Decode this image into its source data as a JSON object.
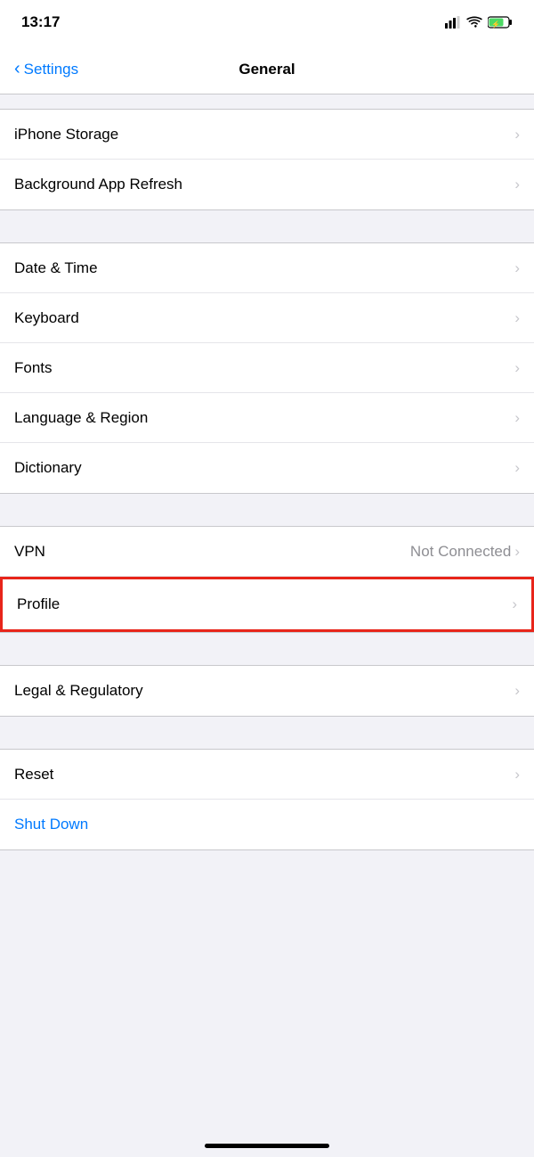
{
  "statusBar": {
    "time": "13:17"
  },
  "navBar": {
    "backLabel": "Settings",
    "title": "General"
  },
  "sections": [
    {
      "id": "storage-refresh",
      "items": [
        {
          "label": "iPhone Storage",
          "value": "",
          "chevron": "›"
        },
        {
          "label": "Background App Refresh",
          "value": "",
          "chevron": "›"
        }
      ]
    },
    {
      "id": "datetime-language",
      "items": [
        {
          "label": "Date & Time",
          "value": "",
          "chevron": "›"
        },
        {
          "label": "Keyboard",
          "value": "",
          "chevron": "›"
        },
        {
          "label": "Fonts",
          "value": "",
          "chevron": "›"
        },
        {
          "label": "Language & Region",
          "value": "",
          "chevron": "›"
        },
        {
          "label": "Dictionary",
          "value": "",
          "chevron": "›"
        }
      ]
    },
    {
      "id": "vpn-profile",
      "items": [
        {
          "label": "VPN",
          "value": "Not Connected",
          "chevron": "›"
        },
        {
          "label": "Profile",
          "value": "",
          "chevron": "›",
          "highlighted": true
        }
      ]
    },
    {
      "id": "legal",
      "items": [
        {
          "label": "Legal & Regulatory",
          "value": "",
          "chevron": "›"
        }
      ]
    },
    {
      "id": "reset",
      "items": [
        {
          "label": "Reset",
          "value": "",
          "chevron": "›"
        },
        {
          "label": "Shut Down",
          "value": "",
          "chevron": "",
          "blue": true
        }
      ]
    }
  ],
  "icons": {
    "signal": "signal-icon",
    "wifi": "wifi-icon",
    "battery": "battery-icon"
  }
}
